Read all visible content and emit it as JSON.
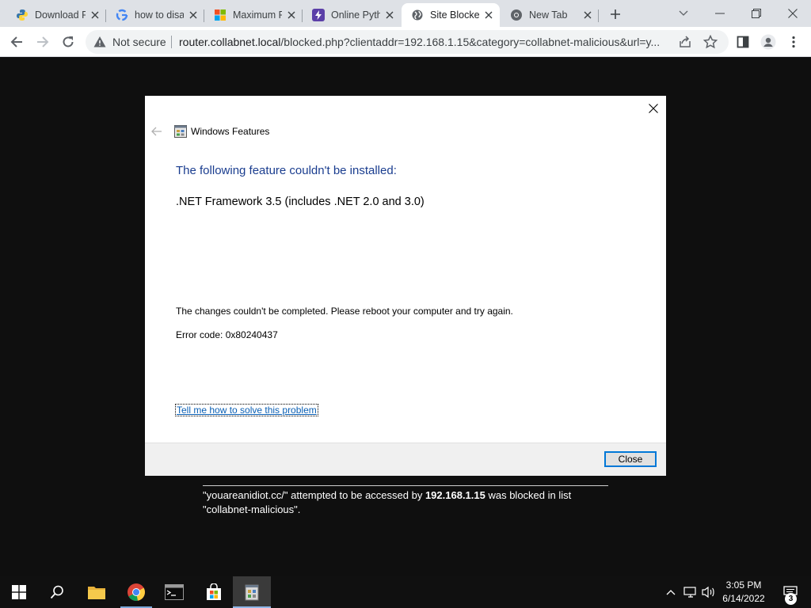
{
  "browser": {
    "tabs": [
      {
        "title": "Download Python",
        "icon": "python-icon"
      },
      {
        "title": "how to disable",
        "icon": "google-icon"
      },
      {
        "title": "Maximum Path",
        "icon": "microsoft-icon"
      },
      {
        "title": "Online Python",
        "icon": "lightning-icon"
      },
      {
        "title": "Site Blocked",
        "icon": "globe-icon",
        "active": true
      },
      {
        "title": "New Tab",
        "icon": "chrome-icon"
      }
    ],
    "omnibox": {
      "security_label": "Not secure",
      "url_host": "router.collabnet.local",
      "url_rest": "/blocked.php?clientaddr=192.168.1.15&category=collabnet-malicious&url=y..."
    }
  },
  "dialog": {
    "app_title": "Windows Features",
    "heading": "The following feature couldn't be installed:",
    "feature": ".NET Framework 3.5 (includes .NET 2.0 and 3.0)",
    "message": "The changes couldn't be completed. Please reboot your computer and try again.",
    "error_code": "Error code: 0x80240437",
    "help_link": "Tell me how to solve this problem",
    "close_button": "Close"
  },
  "blocked": {
    "site": "\"youareanidiot.cc/\"",
    "middle": " attempted to be accessed by ",
    "ip": "192.168.1.15",
    "tail": " was blocked in list ",
    "list": "\"collabnet-malicious\"."
  },
  "taskbar": {
    "time": "3:05 PM",
    "date": "6/14/2022",
    "notifications": "3"
  },
  "colors": {
    "accent": "#0078d7",
    "heading": "#1a3d8f",
    "link": "#0a5fb4",
    "page_bg": "#0f0f0f"
  }
}
